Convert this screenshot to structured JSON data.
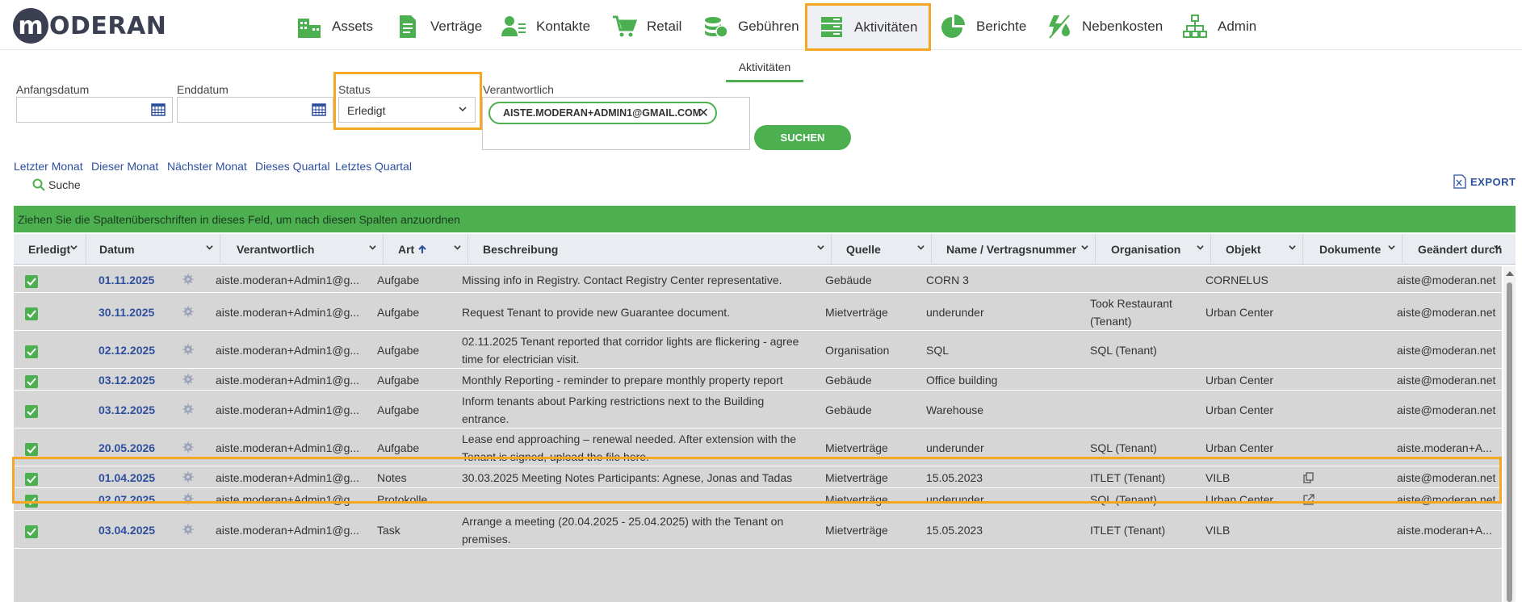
{
  "logo": {
    "mark": "m",
    "text": "ODERAN"
  },
  "nav": [
    {
      "label": "Assets",
      "icon": "buildings-icon"
    },
    {
      "label": "Verträge",
      "icon": "document-icon"
    },
    {
      "label": "Kontakte",
      "icon": "contacts-icon"
    },
    {
      "label": "Retail",
      "icon": "cart-icon"
    },
    {
      "label": "Gebühren",
      "icon": "coins-icon"
    },
    {
      "label": "Aktivitäten",
      "icon": "activities-icon",
      "active": true
    },
    {
      "label": "Berichte",
      "icon": "pie-chart-icon"
    },
    {
      "label": "Nebenkosten",
      "icon": "utilities-icon"
    },
    {
      "label": "Admin",
      "icon": "org-chart-icon"
    }
  ],
  "subtab": "Aktivitäten",
  "filters": {
    "start_label": "Anfangsdatum",
    "end_label": "Enddatum",
    "status_label": "Status",
    "status_value": "Erledigt",
    "responsible_label": "Verantwortlich",
    "responsible_chip": "AISTE.MODERAN+ADMIN1@GMAIL.COM",
    "search_button": "SUCHEN"
  },
  "quick_links": [
    "Letzter Monat",
    "Dieser Monat",
    "Nächster Monat",
    "Dieses Quartal",
    "Letztes Quartal"
  ],
  "search_toggle": "Suche",
  "export": "EXPORT",
  "group_hint": "Ziehen Sie die Spaltenüberschriften in dieses Feld, um nach diesen Spalten anzuordnen",
  "columns": [
    "Erledigt",
    "Datum",
    "Verantwortlich",
    "Art",
    "Beschreibung",
    "Quelle",
    "Name / Vertragsnummer",
    "Organisation",
    "Objekt",
    "Dokumente",
    "Geändert durch"
  ],
  "rows": [
    {
      "date": "01.11.2025",
      "resp": "aiste.moderan+Admin1@g...",
      "art": "Aufgabe",
      "desc": "Missing info in Registry. Contact Registry Center representative.",
      "quelle": "Gebäude",
      "name": "CORN 3",
      "org": "",
      "objekt": "CORNELUS",
      "doc": "",
      "changed": "aiste@moderan.net"
    },
    {
      "date": "30.11.2025",
      "resp": "aiste.moderan+Admin1@g...",
      "art": "Aufgabe",
      "desc": "Request Tenant to provide new Guarantee document.",
      "quelle": "Mietverträge",
      "name": "underunder",
      "org": "Took Restaurant (Tenant)",
      "objekt": "Urban Center",
      "doc": "",
      "changed": "aiste@moderan.net"
    },
    {
      "date": "02.12.2025",
      "resp": "aiste.moderan+Admin1@g...",
      "art": "Aufgabe",
      "desc": "02.11.2025 Tenant reported that corridor lights are flickering - agree time for electrician visit.",
      "quelle": "Organisation",
      "name": "SQL",
      "org": "SQL (Tenant)",
      "objekt": "",
      "doc": "",
      "changed": "aiste@moderan.net"
    },
    {
      "date": "03.12.2025",
      "resp": "aiste.moderan+Admin1@g...",
      "art": "Aufgabe",
      "desc": "Monthly Reporting - reminder to prepare monthly property report",
      "quelle": "Gebäude",
      "name": "Office building",
      "org": "",
      "objekt": "Urban Center",
      "doc": "",
      "changed": "aiste@moderan.net"
    },
    {
      "date": "03.12.2025",
      "resp": "aiste.moderan+Admin1@g...",
      "art": "Aufgabe",
      "desc": "Inform tenants about Parking restrictions next to the Building entrance.",
      "quelle": "Gebäude",
      "name": "Warehouse",
      "org": "",
      "objekt": "Urban Center",
      "doc": "",
      "changed": "aiste@moderan.net"
    },
    {
      "date": "20.05.2026",
      "resp": "aiste.moderan+Admin1@g...",
      "art": "Aufgabe",
      "desc": "Lease end approaching – renewal needed. After extension with the Tenant is signed, upload the file here.",
      "quelle": "Mietverträge",
      "name": "underunder",
      "org": "SQL (Tenant)",
      "objekt": "Urban Center",
      "doc": "",
      "changed": "aiste.moderan+A..."
    },
    {
      "date": "01.04.2025",
      "resp": "aiste.moderan+Admin1@g...",
      "art": "Notes",
      "desc": "30.03.2025 Meeting Notes Participants: Agnese, Jonas and Tadas",
      "quelle": "Mietverträge",
      "name": "15.05.2023",
      "org": "ITLET (Tenant)",
      "objekt": "VILB",
      "doc": "copy-icon",
      "changed": "aiste@moderan.net"
    },
    {
      "date": "02.07.2025",
      "resp": "aiste.moderan+Admin1@g...",
      "art": "Protokolle",
      "desc": "",
      "quelle": "Mietverträge",
      "name": "underunder",
      "org": "SQL (Tenant)",
      "objekt": "Urban Center",
      "doc": "external-link-icon",
      "changed": "aiste@moderan.net"
    },
    {
      "date": "03.04.2025",
      "resp": "aiste.moderan+Admin1@g...",
      "art": "Task",
      "desc": "Arrange a meeting (20.04.2025 - 25.04.2025) with the Tenant on premises.",
      "quelle": "Mietverträge",
      "name": "15.05.2023",
      "org": "ITLET (Tenant)",
      "objekt": "VILB",
      "doc": "",
      "changed": "aiste.moderan+A..."
    }
  ],
  "colors": {
    "accent": "#4caf50",
    "highlight": "#f5a623",
    "link": "#2d4f9e",
    "row_bg": "#d6d6d6",
    "header_bg": "#e9ecf1"
  }
}
